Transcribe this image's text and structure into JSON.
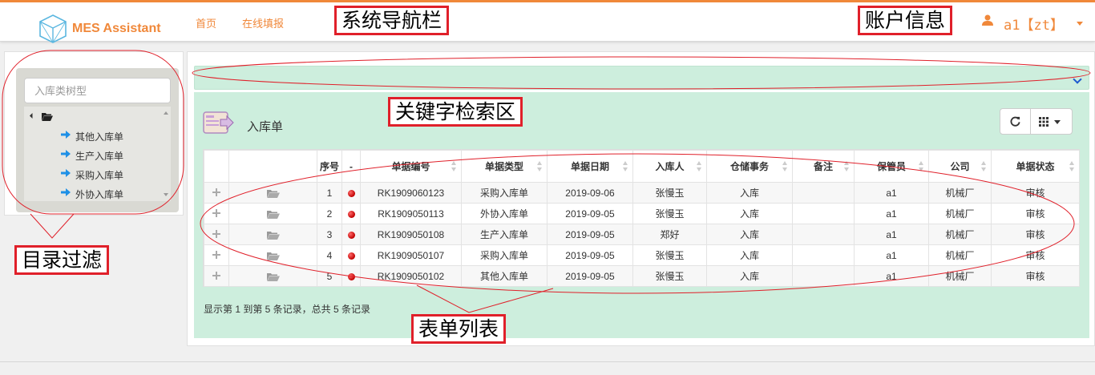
{
  "app": {
    "brand": "MES Assistant",
    "nav": [
      {
        "label": "首页"
      },
      {
        "label": "在线填报"
      }
    ],
    "user": {
      "name": "a1【zt】"
    },
    "accent_color": "#f0883a"
  },
  "tree": {
    "search_placeholder": "入库类树型",
    "root_icon": "folder-open-icon",
    "items": [
      {
        "label": "其他入库单",
        "icon": "arrow-right-icon"
      },
      {
        "label": "生产入库单",
        "icon": "arrow-right-icon"
      },
      {
        "label": "采购入库单",
        "icon": "arrow-right-icon"
      },
      {
        "label": "外协入库单",
        "icon": "arrow-right-icon"
      }
    ]
  },
  "panel": {
    "title": "入库单",
    "tools": [
      {
        "icon": "refresh-icon"
      },
      {
        "icon": "grid-columns-icon"
      }
    ],
    "panel_color": "#cdeedd"
  },
  "table": {
    "columns": [
      "",
      "",
      "序号",
      "-",
      "单据编号",
      "单据类型",
      "单据日期",
      "入库人",
      "仓储事务",
      "备注",
      "保管员",
      "公司",
      "单据状态"
    ],
    "rows": [
      {
        "seq": "1",
        "code": "RK1909060123",
        "type": "采购入库单",
        "date": "2019-09-06",
        "person": "张慢玉",
        "affair": "入库",
        "remark": "",
        "keeper": "a1",
        "company": "机械厂",
        "status": "审核"
      },
      {
        "seq": "2",
        "code": "RK1909050113",
        "type": "外协入库单",
        "date": "2019-09-05",
        "person": "张慢玉",
        "affair": "入库",
        "remark": "",
        "keeper": "a1",
        "company": "机械厂",
        "status": "审核"
      },
      {
        "seq": "3",
        "code": "RK1909050108",
        "type": "生产入库单",
        "date": "2019-09-05",
        "person": "郑好",
        "affair": "入库",
        "remark": "",
        "keeper": "a1",
        "company": "机械厂",
        "status": "审核"
      },
      {
        "seq": "4",
        "code": "RK1909050107",
        "type": "采购入库单",
        "date": "2019-09-05",
        "person": "张慢玉",
        "affair": "入库",
        "remark": "",
        "keeper": "a1",
        "company": "机械厂",
        "status": "审核"
      },
      {
        "seq": "5",
        "code": "RK1909050102",
        "type": "其他入库单",
        "date": "2019-09-05",
        "person": "张慢玉",
        "affair": "入库",
        "remark": "",
        "keeper": "a1",
        "company": "机械厂",
        "status": "审核"
      }
    ],
    "pagination": "显示第 1 到第 5 条记录，总共 5 条记录"
  },
  "annotations": {
    "nav": "系统导航栏",
    "account": "账户信息",
    "search": "关键字检索区",
    "filter": "目录过滤",
    "list": "表单列表",
    "color": "#e0202a"
  }
}
